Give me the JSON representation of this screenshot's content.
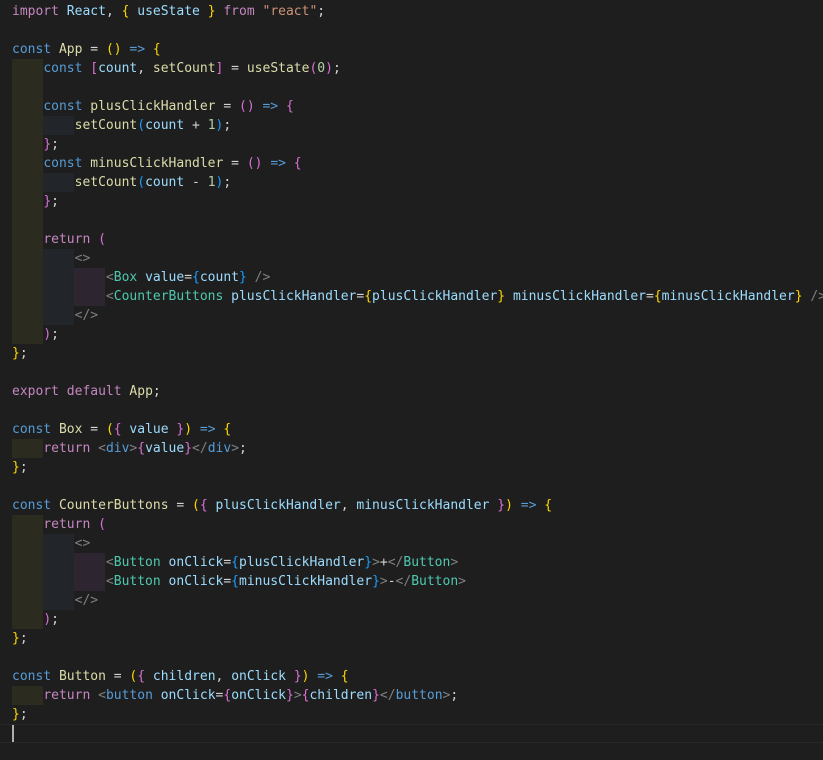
{
  "editor": {
    "lines": [
      [
        {
          "t": "import",
          "c": "kw"
        },
        {
          "t": " ",
          "c": "plain"
        },
        {
          "t": "React",
          "c": "var"
        },
        {
          "t": ", ",
          "c": "plain"
        },
        {
          "t": "{",
          "c": "br1"
        },
        {
          "t": " ",
          "c": "plain"
        },
        {
          "t": "useState",
          "c": "var"
        },
        {
          "t": " ",
          "c": "plain"
        },
        {
          "t": "}",
          "c": "br1"
        },
        {
          "t": " ",
          "c": "plain"
        },
        {
          "t": "from",
          "c": "kw"
        },
        {
          "t": " ",
          "c": "plain"
        },
        {
          "t": "\"react\"",
          "c": "str"
        },
        {
          "t": ";",
          "c": "plain"
        }
      ],
      [],
      [
        {
          "t": "const",
          "c": "kwb"
        },
        {
          "t": " ",
          "c": "plain"
        },
        {
          "t": "App",
          "c": "fn"
        },
        {
          "t": " = ",
          "c": "plain"
        },
        {
          "t": "()",
          "c": "br1"
        },
        {
          "t": " ",
          "c": "plain"
        },
        {
          "t": "=>",
          "c": "kwb"
        },
        {
          "t": " ",
          "c": "plain"
        },
        {
          "t": "{",
          "c": "br1"
        }
      ],
      [
        {
          "t": "    ",
          "c": "plain"
        },
        {
          "t": "const",
          "c": "kwb"
        },
        {
          "t": " ",
          "c": "plain"
        },
        {
          "t": "[",
          "c": "br2"
        },
        {
          "t": "count",
          "c": "var"
        },
        {
          "t": ", ",
          "c": "plain"
        },
        {
          "t": "setCount",
          "c": "fn"
        },
        {
          "t": "]",
          "c": "br2"
        },
        {
          "t": " = ",
          "c": "plain"
        },
        {
          "t": "useState",
          "c": "fn"
        },
        {
          "t": "(",
          "c": "br2"
        },
        {
          "t": "0",
          "c": "num"
        },
        {
          "t": ")",
          "c": "br2"
        },
        {
          "t": ";",
          "c": "plain"
        }
      ],
      [],
      [
        {
          "t": "    ",
          "c": "plain"
        },
        {
          "t": "const",
          "c": "kwb"
        },
        {
          "t": " ",
          "c": "plain"
        },
        {
          "t": "plusClickHandler",
          "c": "fn"
        },
        {
          "t": " = ",
          "c": "plain"
        },
        {
          "t": "()",
          "c": "br2"
        },
        {
          "t": " ",
          "c": "plain"
        },
        {
          "t": "=>",
          "c": "kwb"
        },
        {
          "t": " ",
          "c": "plain"
        },
        {
          "t": "{",
          "c": "br2"
        }
      ],
      [
        {
          "t": "        ",
          "c": "plain"
        },
        {
          "t": "setCount",
          "c": "fn"
        },
        {
          "t": "(",
          "c": "br3"
        },
        {
          "t": "count",
          "c": "var"
        },
        {
          "t": " + ",
          "c": "plain"
        },
        {
          "t": "1",
          "c": "num"
        },
        {
          "t": ")",
          "c": "br3"
        },
        {
          "t": ";",
          "c": "plain"
        }
      ],
      [
        {
          "t": "    ",
          "c": "plain"
        },
        {
          "t": "}",
          "c": "br2"
        },
        {
          "t": ";",
          "c": "plain"
        }
      ],
      [
        {
          "t": "    ",
          "c": "plain"
        },
        {
          "t": "const",
          "c": "kwb"
        },
        {
          "t": " ",
          "c": "plain"
        },
        {
          "t": "minusClickHandler",
          "c": "fn"
        },
        {
          "t": " = ",
          "c": "plain"
        },
        {
          "t": "()",
          "c": "br2"
        },
        {
          "t": " ",
          "c": "plain"
        },
        {
          "t": "=>",
          "c": "kwb"
        },
        {
          "t": " ",
          "c": "plain"
        },
        {
          "t": "{",
          "c": "br2"
        }
      ],
      [
        {
          "t": "        ",
          "c": "plain"
        },
        {
          "t": "setCount",
          "c": "fn"
        },
        {
          "t": "(",
          "c": "br3"
        },
        {
          "t": "count",
          "c": "var"
        },
        {
          "t": " - ",
          "c": "plain"
        },
        {
          "t": "1",
          "c": "num"
        },
        {
          "t": ")",
          "c": "br3"
        },
        {
          "t": ";",
          "c": "plain"
        }
      ],
      [
        {
          "t": "    ",
          "c": "plain"
        },
        {
          "t": "}",
          "c": "br2"
        },
        {
          "t": ";",
          "c": "plain"
        }
      ],
      [],
      [
        {
          "t": "    ",
          "c": "plain"
        },
        {
          "t": "return",
          "c": "kw"
        },
        {
          "t": " ",
          "c": "plain"
        },
        {
          "t": "(",
          "c": "br2"
        }
      ],
      [
        {
          "t": "        ",
          "c": "plain"
        },
        {
          "t": "<>",
          "c": "tag"
        }
      ],
      [
        {
          "t": "            ",
          "c": "plain"
        },
        {
          "t": "<",
          "c": "tag"
        },
        {
          "t": "Box",
          "c": "comp"
        },
        {
          "t": " ",
          "c": "plain"
        },
        {
          "t": "value",
          "c": "var"
        },
        {
          "t": "=",
          "c": "plain"
        },
        {
          "t": "{",
          "c": "br3"
        },
        {
          "t": "count",
          "c": "var"
        },
        {
          "t": "}",
          "c": "br3"
        },
        {
          "t": " ",
          "c": "plain"
        },
        {
          "t": "/>",
          "c": "tag"
        }
      ],
      [
        {
          "t": "            ",
          "c": "plain"
        },
        {
          "t": "<",
          "c": "tag"
        },
        {
          "t": "CounterButtons",
          "c": "comp"
        },
        {
          "t": " ",
          "c": "plain"
        },
        {
          "t": "plusClickHandler",
          "c": "var"
        },
        {
          "t": "=",
          "c": "plain"
        },
        {
          "t": "{",
          "c": "br1"
        },
        {
          "t": "plusClickHandler",
          "c": "var"
        },
        {
          "t": "}",
          "c": "br1"
        },
        {
          "t": " ",
          "c": "plain"
        },
        {
          "t": "minusClickHandler",
          "c": "var"
        },
        {
          "t": "=",
          "c": "plain"
        },
        {
          "t": "{",
          "c": "br1"
        },
        {
          "t": "minusClickHandler",
          "c": "var"
        },
        {
          "t": "}",
          "c": "br1"
        },
        {
          "t": " ",
          "c": "plain"
        },
        {
          "t": "/>",
          "c": "tag"
        }
      ],
      [
        {
          "t": "        ",
          "c": "plain"
        },
        {
          "t": "</>",
          "c": "tag"
        }
      ],
      [
        {
          "t": "    ",
          "c": "plain"
        },
        {
          "t": ")",
          "c": "br2"
        },
        {
          "t": ";",
          "c": "plain"
        }
      ],
      [
        {
          "t": "}",
          "c": "br1"
        },
        {
          "t": ";",
          "c": "plain"
        }
      ],
      [],
      [
        {
          "t": "export",
          "c": "kw"
        },
        {
          "t": " ",
          "c": "plain"
        },
        {
          "t": "default",
          "c": "kw"
        },
        {
          "t": " ",
          "c": "plain"
        },
        {
          "t": "App",
          "c": "fn"
        },
        {
          "t": ";",
          "c": "plain"
        }
      ],
      [],
      [
        {
          "t": "const",
          "c": "kwb"
        },
        {
          "t": " ",
          "c": "plain"
        },
        {
          "t": "Box",
          "c": "fn"
        },
        {
          "t": " = ",
          "c": "plain"
        },
        {
          "t": "(",
          "c": "br1"
        },
        {
          "t": "{",
          "c": "br2"
        },
        {
          "t": " ",
          "c": "plain"
        },
        {
          "t": "value",
          "c": "var"
        },
        {
          "t": " ",
          "c": "plain"
        },
        {
          "t": "}",
          "c": "br2"
        },
        {
          "t": ")",
          "c": "br1"
        },
        {
          "t": " ",
          "c": "plain"
        },
        {
          "t": "=>",
          "c": "kwb"
        },
        {
          "t": " ",
          "c": "plain"
        },
        {
          "t": "{",
          "c": "br1"
        }
      ],
      [
        {
          "t": "    ",
          "c": "plain"
        },
        {
          "t": "return",
          "c": "kw"
        },
        {
          "t": " ",
          "c": "plain"
        },
        {
          "t": "<",
          "c": "tag"
        },
        {
          "t": "div",
          "c": "kwb"
        },
        {
          "t": ">",
          "c": "tag"
        },
        {
          "t": "{",
          "c": "br2"
        },
        {
          "t": "value",
          "c": "var"
        },
        {
          "t": "}",
          "c": "br2"
        },
        {
          "t": "</",
          "c": "tag"
        },
        {
          "t": "div",
          "c": "kwb"
        },
        {
          "t": ">",
          "c": "tag"
        },
        {
          "t": ";",
          "c": "plain"
        }
      ],
      [
        {
          "t": "}",
          "c": "br1"
        },
        {
          "t": ";",
          "c": "plain"
        }
      ],
      [],
      [
        {
          "t": "const",
          "c": "kwb"
        },
        {
          "t": " ",
          "c": "plain"
        },
        {
          "t": "CounterButtons",
          "c": "fn"
        },
        {
          "t": " = ",
          "c": "plain"
        },
        {
          "t": "(",
          "c": "br1"
        },
        {
          "t": "{",
          "c": "br2"
        },
        {
          "t": " ",
          "c": "plain"
        },
        {
          "t": "plusClickHandler",
          "c": "var"
        },
        {
          "t": ", ",
          "c": "plain"
        },
        {
          "t": "minusClickHandler",
          "c": "var"
        },
        {
          "t": " ",
          "c": "plain"
        },
        {
          "t": "}",
          "c": "br2"
        },
        {
          "t": ")",
          "c": "br1"
        },
        {
          "t": " ",
          "c": "plain"
        },
        {
          "t": "=>",
          "c": "kwb"
        },
        {
          "t": " ",
          "c": "plain"
        },
        {
          "t": "{",
          "c": "br1"
        }
      ],
      [
        {
          "t": "    ",
          "c": "plain"
        },
        {
          "t": "return",
          "c": "kw"
        },
        {
          "t": " ",
          "c": "plain"
        },
        {
          "t": "(",
          "c": "br2"
        }
      ],
      [
        {
          "t": "        ",
          "c": "plain"
        },
        {
          "t": "<>",
          "c": "tag"
        }
      ],
      [
        {
          "t": "            ",
          "c": "plain"
        },
        {
          "t": "<",
          "c": "tag"
        },
        {
          "t": "Button",
          "c": "comp"
        },
        {
          "t": " ",
          "c": "plain"
        },
        {
          "t": "onClick",
          "c": "var"
        },
        {
          "t": "=",
          "c": "plain"
        },
        {
          "t": "{",
          "c": "br3"
        },
        {
          "t": "plusClickHandler",
          "c": "var"
        },
        {
          "t": "}",
          "c": "br3"
        },
        {
          "t": ">",
          "c": "tag"
        },
        {
          "t": "+",
          "c": "plain"
        },
        {
          "t": "</",
          "c": "tag"
        },
        {
          "t": "Button",
          "c": "comp"
        },
        {
          "t": ">",
          "c": "tag"
        }
      ],
      [
        {
          "t": "            ",
          "c": "plain"
        },
        {
          "t": "<",
          "c": "tag"
        },
        {
          "t": "Button",
          "c": "comp"
        },
        {
          "t": " ",
          "c": "plain"
        },
        {
          "t": "onClick",
          "c": "var"
        },
        {
          "t": "=",
          "c": "plain"
        },
        {
          "t": "{",
          "c": "br3"
        },
        {
          "t": "minusClickHandler",
          "c": "var"
        },
        {
          "t": "}",
          "c": "br3"
        },
        {
          "t": ">",
          "c": "tag"
        },
        {
          "t": "-",
          "c": "plain"
        },
        {
          "t": "</",
          "c": "tag"
        },
        {
          "t": "Button",
          "c": "comp"
        },
        {
          "t": ">",
          "c": "tag"
        }
      ],
      [
        {
          "t": "        ",
          "c": "plain"
        },
        {
          "t": "</>",
          "c": "tag"
        }
      ],
      [
        {
          "t": "    ",
          "c": "plain"
        },
        {
          "t": ")",
          "c": "br2"
        },
        {
          "t": ";",
          "c": "plain"
        }
      ],
      [
        {
          "t": "}",
          "c": "br1"
        },
        {
          "t": ";",
          "c": "plain"
        }
      ],
      [],
      [
        {
          "t": "const",
          "c": "kwb"
        },
        {
          "t": " ",
          "c": "plain"
        },
        {
          "t": "Button",
          "c": "fn"
        },
        {
          "t": " = ",
          "c": "plain"
        },
        {
          "t": "(",
          "c": "br1"
        },
        {
          "t": "{",
          "c": "br2"
        },
        {
          "t": " ",
          "c": "plain"
        },
        {
          "t": "children",
          "c": "var"
        },
        {
          "t": ", ",
          "c": "plain"
        },
        {
          "t": "onClick",
          "c": "var"
        },
        {
          "t": " ",
          "c": "plain"
        },
        {
          "t": "}",
          "c": "br2"
        },
        {
          "t": ")",
          "c": "br1"
        },
        {
          "t": " ",
          "c": "plain"
        },
        {
          "t": "=>",
          "c": "kwb"
        },
        {
          "t": " ",
          "c": "plain"
        },
        {
          "t": "{",
          "c": "br1"
        }
      ],
      [
        {
          "t": "    ",
          "c": "plain"
        },
        {
          "t": "return",
          "c": "kw"
        },
        {
          "t": " ",
          "c": "plain"
        },
        {
          "t": "<",
          "c": "tag"
        },
        {
          "t": "button",
          "c": "kwb"
        },
        {
          "t": " ",
          "c": "plain"
        },
        {
          "t": "onClick",
          "c": "var"
        },
        {
          "t": "=",
          "c": "plain"
        },
        {
          "t": "{",
          "c": "br2"
        },
        {
          "t": "onClick",
          "c": "var"
        },
        {
          "t": "}",
          "c": "br2"
        },
        {
          "t": ">",
          "c": "tag"
        },
        {
          "t": "{",
          "c": "br2"
        },
        {
          "t": "children",
          "c": "var"
        },
        {
          "t": "}",
          "c": "br2"
        },
        {
          "t": "</",
          "c": "tag"
        },
        {
          "t": "button",
          "c": "kwb"
        },
        {
          "t": ">",
          "c": "tag"
        },
        {
          "t": ";",
          "c": "plain"
        }
      ],
      [
        {
          "t": "}",
          "c": "br1"
        },
        {
          "t": ";",
          "c": "plain"
        }
      ]
    ],
    "indent_levels": [
      0,
      0,
      0,
      1,
      1,
      1,
      2,
      1,
      1,
      2,
      1,
      1,
      1,
      2,
      3,
      3,
      2,
      1,
      0,
      0,
      0,
      0,
      0,
      1,
      0,
      0,
      0,
      1,
      2,
      3,
      3,
      2,
      1,
      0,
      0,
      0,
      1,
      0
    ],
    "colors": {
      "background": "#1e1e1e",
      "keyword_control": "#c586c0",
      "keyword_storage": "#569cd6",
      "function": "#dcdcaa",
      "variable": "#9cdcfe",
      "string": "#ce9178",
      "number": "#b5cea8",
      "component": "#4ec9b0",
      "tag_punctuation": "#808080",
      "bracket_level1": "#ffd700",
      "bracket_level2": "#da70d6",
      "bracket_level3": "#179fff"
    }
  }
}
